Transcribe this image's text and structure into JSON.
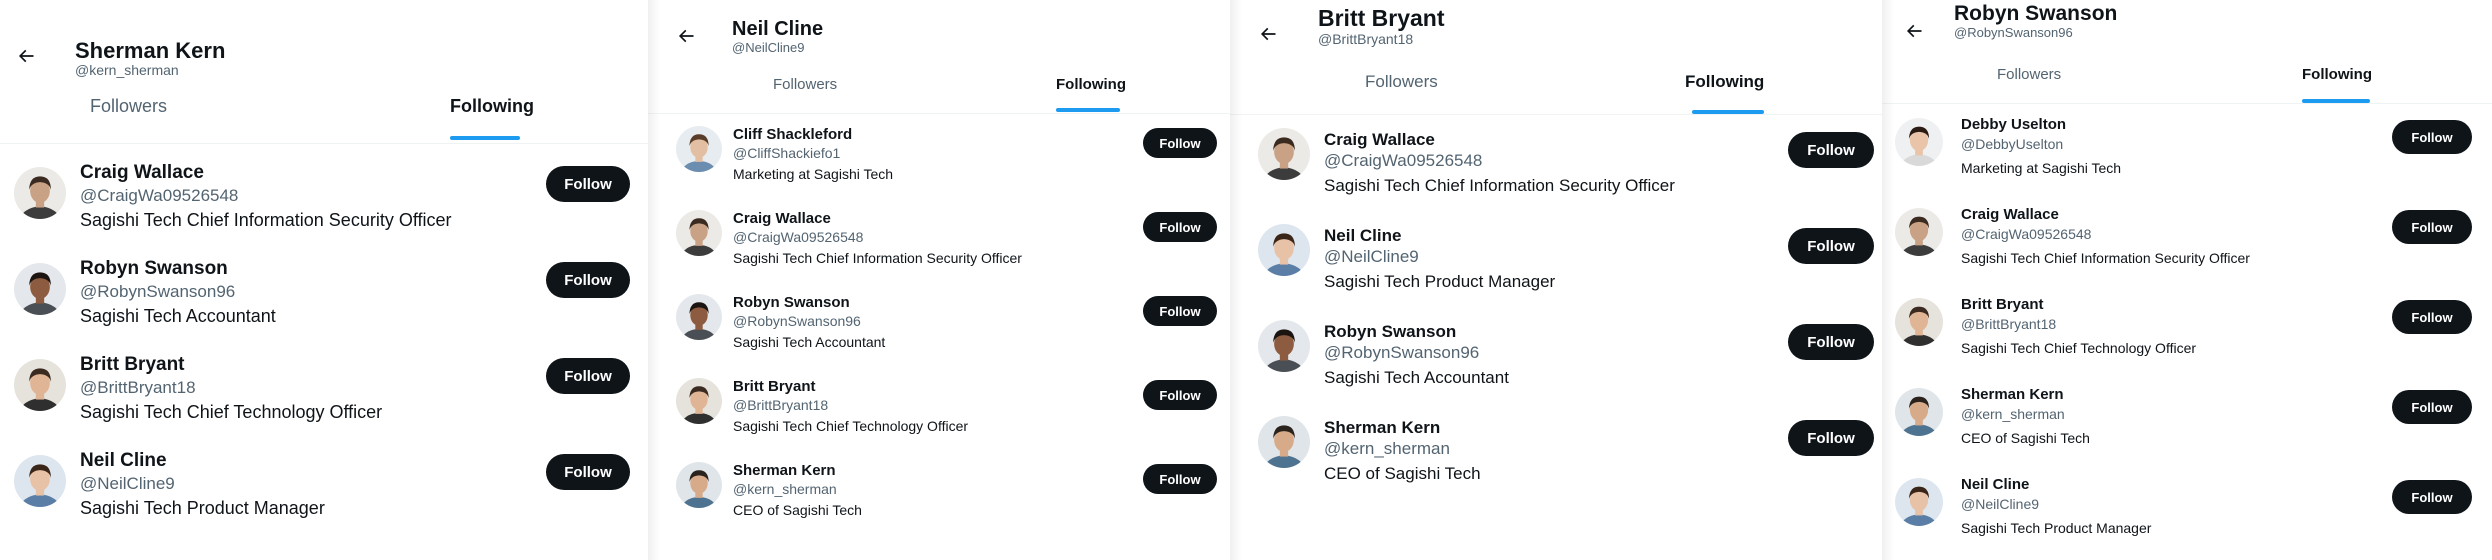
{
  "icons": {
    "back": "arrow-left-icon",
    "avatar": "profile-photo"
  },
  "colors": {
    "accent": "#1d9bf0",
    "button": "#0f1419",
    "secondary_text": "#536471"
  },
  "panels": [
    {
      "title": "Sherman Kern",
      "handle": "@kern_sherman",
      "tabs": [
        "Followers",
        "Following"
      ],
      "active_tab": "Following",
      "users": [
        {
          "name": "Craig Wallace",
          "handle": "@CraigWa09526548",
          "bio": "Sagishi Tech Chief Information Security Officer",
          "button": "Follow"
        },
        {
          "name": "Robyn Swanson",
          "handle": "@RobynSwanson96",
          "bio": "Sagishi Tech Accountant",
          "button": "Follow"
        },
        {
          "name": "Britt Bryant",
          "handle": "@BrittBryant18",
          "bio": "Sagishi Tech Chief Technology Officer",
          "button": "Follow"
        },
        {
          "name": "Neil Cline",
          "handle": "@NeilCline9",
          "bio": "Sagishi Tech Product Manager",
          "button": "Follow"
        }
      ]
    },
    {
      "title": "Neil Cline",
      "handle": "@NeilCline9",
      "tabs": [
        "Followers",
        "Following"
      ],
      "active_tab": "Following",
      "users": [
        {
          "name": "Cliff Shackleford",
          "handle": "@CliffShackiefo1",
          "bio": "Marketing at Sagishi Tech",
          "button": "Follow"
        },
        {
          "name": "Craig Wallace",
          "handle": "@CraigWa09526548",
          "bio": "Sagishi Tech Chief Information Security Officer",
          "button": "Follow"
        },
        {
          "name": "Robyn Swanson",
          "handle": "@RobynSwanson96",
          "bio": "Sagishi Tech Accountant",
          "button": "Follow"
        },
        {
          "name": "Britt Bryant",
          "handle": "@BrittBryant18",
          "bio": "Sagishi Tech Chief Technology Officer",
          "button": "Follow"
        },
        {
          "name": "Sherman Kern",
          "handle": "@kern_sherman",
          "bio": "CEO of Sagishi Tech",
          "button": "Follow"
        }
      ]
    },
    {
      "title": "Britt Bryant",
      "handle": "@BrittBryant18",
      "tabs": [
        "Followers",
        "Following"
      ],
      "active_tab": "Following",
      "users": [
        {
          "name": "Craig Wallace",
          "handle": "@CraigWa09526548",
          "bio": "Sagishi Tech Chief Information Security Officer",
          "button": "Follow"
        },
        {
          "name": "Neil Cline",
          "handle": "@NeilCline9",
          "bio": "Sagishi Tech Product Manager",
          "button": "Follow"
        },
        {
          "name": "Robyn Swanson",
          "handle": "@RobynSwanson96",
          "bio": "Sagishi Tech Accountant",
          "button": "Follow"
        },
        {
          "name": "Sherman Kern",
          "handle": "@kern_sherman",
          "bio": "CEO of Sagishi Tech",
          "button": "Follow"
        }
      ]
    },
    {
      "title": "Robyn Swanson",
      "handle": "@RobynSwanson96",
      "tabs": [
        "Followers",
        "Following"
      ],
      "active_tab": "Following",
      "users": [
        {
          "name": "Debby Uselton",
          "handle": "@DebbyUselton",
          "bio": "Marketing at Sagishi Tech",
          "button": "Follow"
        },
        {
          "name": "Craig Wallace",
          "handle": "@CraigWa09526548",
          "bio": "Sagishi Tech Chief Information Security Officer",
          "button": "Follow"
        },
        {
          "name": "Britt Bryant",
          "handle": "@BrittBryant18",
          "bio": "Sagishi Tech Chief Technology Officer",
          "button": "Follow"
        },
        {
          "name": "Sherman Kern",
          "handle": "@kern_sherman",
          "bio": "CEO of Sagishi Tech",
          "button": "Follow"
        },
        {
          "name": "Neil Cline",
          "handle": "@NeilCline9",
          "bio": "Sagishi Tech Product Manager",
          "button": "Follow"
        }
      ]
    }
  ]
}
